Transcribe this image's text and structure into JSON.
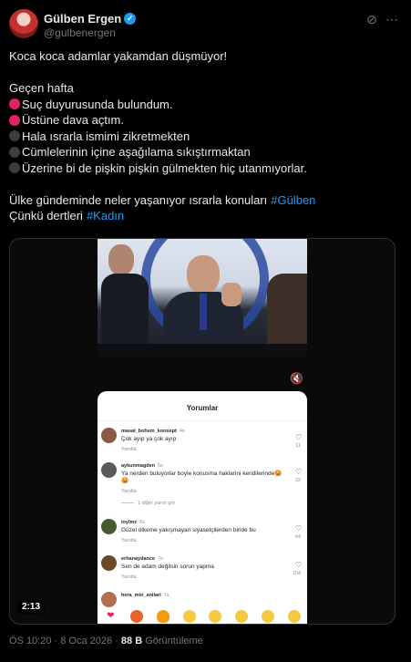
{
  "author": {
    "name": "Gülben Ergen",
    "handle": "@gulbenergen",
    "verified_icon": "verified-badge-icon"
  },
  "header_icons": [
    "grok-icon",
    "more-options-icon"
  ],
  "tweet": {
    "line1": "Koca koca adamlar yakamdan düşmüyor!",
    "line2": "Geçen hafta",
    "items": [
      {
        "dot": "red",
        "text": "Suç duyurusunda bulundum."
      },
      {
        "dot": "red",
        "text": "Üstüne dava açtım."
      },
      {
        "dot": "black",
        "text": "Hala ısrarla ismimi zikretmekten"
      },
      {
        "dot": "black",
        "text": "Cümlelerinin içine aşağılama sıkıştırmaktan"
      },
      {
        "dot": "black",
        "text": "Üzerine bi de pişkin pişkin gülmekten hiç utanmıyorlar."
      }
    ],
    "line3": "Ülke gündeminde neler yaşanıyor ısrarla konuları",
    "hashtag1": "#Gülben",
    "line4": "Çünkü dertleri",
    "hashtag2": "#Kadın"
  },
  "video": {
    "duration": "2:13",
    "mute_icon": "volume-icon",
    "phone": {
      "title": "Yorumlar",
      "comments": [
        {
          "user": "masal_bohem_konsept",
          "age": "4s",
          "text": "Çok ayıp ya çok ayıp",
          "reply": "Yanıtla",
          "likes": "11",
          "avatar_color": "#8a5a44"
        },
        {
          "user": "aykunmagden",
          "age": "6s",
          "text": "Ya nerden buluyorlar boyle konusma haklarini kendilerinde😡😡",
          "reply": "Yanıtla",
          "likes": "32",
          "avatar_color": "#5a5a5a"
        },
        {
          "user": "ioylmz",
          "age": "6s",
          "text": "Güzel ülkeme yakışmayan siyasetçilerden biride bu",
          "reply": "Yanıtla",
          "likes": "64",
          "avatar_color": "#4a5a2e"
        },
        {
          "user": "erhanaydance",
          "age": "7s",
          "text": "Sen de adam değilsin sorun yapma",
          "reply": "Yanıtla",
          "likes": "154",
          "avatar_color": "#6b4a2a"
        },
        {
          "user": "hera_min_anilari",
          "age": "7s",
          "text": "",
          "reply": "",
          "likes": "",
          "avatar_color": "#b07050"
        }
      ],
      "more_replies": "1 diğer yanıtı gör",
      "emojis": [
        "❤",
        "😡",
        "🔥",
        "👏",
        "😢",
        "😍",
        "😮",
        "😂"
      ]
    }
  },
  "meta": {
    "time": "ÖS 10:20 · 8 Oca 2026 · ",
    "views": "88 B",
    "views_label": " Görüntüleme"
  }
}
